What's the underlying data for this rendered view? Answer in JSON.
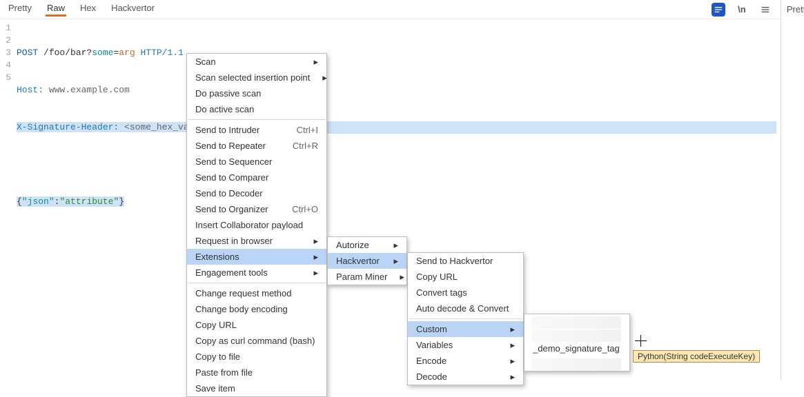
{
  "tabs": {
    "pretty": "Pretty",
    "raw": "Raw",
    "hex": "Hex",
    "hackvertor": "Hackvertor"
  },
  "right": {
    "pretty": "Pretty"
  },
  "code": {
    "l1_method": "POST",
    "l1_path": " /foo/bar?",
    "l1_q1": "some",
    "l1_eq": "=",
    "l1_q2": "arg",
    "l1_proto": " HTTP/1.1",
    "l2_hk": "Host:",
    "l2_hv": " www.example.com",
    "l3_hk": "X-Signature-Header:",
    "l3_hv": " <some_hex_value>",
    "l5_a": "{",
    "l5_b": "\"json\"",
    "l5_c": ":",
    "l5_d": "\"attribute\"",
    "l5_e": "}"
  },
  "m1": {
    "scan": "Scan",
    "scanSel": "Scan selected insertion point",
    "passive": "Do passive scan",
    "active": "Do active scan",
    "intruder": "Send to Intruder",
    "intruder_sc": "Ctrl+I",
    "repeater": "Send to Repeater",
    "repeater_sc": "Ctrl+R",
    "sequencer": "Send to Sequencer",
    "comparer": "Send to Comparer",
    "decoder": "Send to Decoder",
    "organizer": "Send to Organizer",
    "organizer_sc": "Ctrl+O",
    "collab": "Insert Collaborator payload",
    "reqBrowser": "Request in browser",
    "extensions": "Extensions",
    "engagement": "Engagement tools",
    "chReqMethod": "Change request method",
    "chBodyEnc": "Change body encoding",
    "copyUrl": "Copy URL",
    "copyCurl": "Copy as curl command (bash)",
    "copyFile": "Copy to file",
    "pasteFile": "Paste from file",
    "saveItem": "Save item"
  },
  "m2": {
    "autorize": "Autorize",
    "hackvertor": "Hackvertor",
    "paramMiner": "Param Miner"
  },
  "m3": {
    "sendHack": "Send to Hackvertor",
    "copyUrl": "Copy URL",
    "convertTags": "Convert tags",
    "autoDecode": "Auto decode & Convert",
    "custom": "Custom",
    "variables": "Variables",
    "encode": "Encode",
    "decode": "Decode"
  },
  "m4": {
    "demoTag": "_demo_signature_tag"
  },
  "tooltip": "Python(String codeExecuteKey)"
}
